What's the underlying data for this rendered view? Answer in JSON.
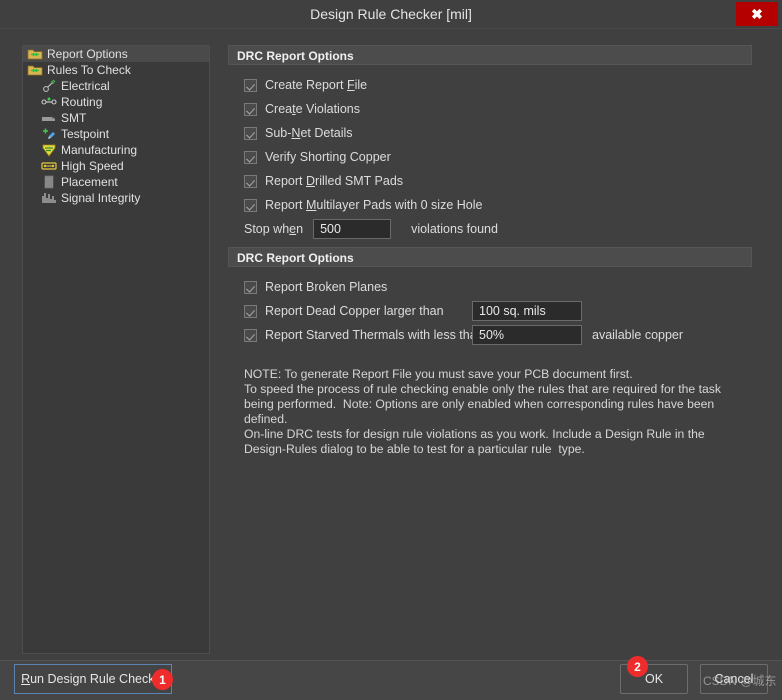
{
  "window": {
    "title": "Design Rule Checker [mil]",
    "close_label": "✖"
  },
  "sidebar": {
    "items": [
      {
        "label": "Report Options",
        "icon": "folder-arrows-icon",
        "level": 0,
        "selected": true
      },
      {
        "label": "Rules To Check",
        "icon": "folder-arrows-icon",
        "level": 0,
        "selected": false
      },
      {
        "label": "Electrical",
        "icon": "electrical-icon",
        "level": 1,
        "selected": false
      },
      {
        "label": "Routing",
        "icon": "routing-icon",
        "level": 1,
        "selected": false
      },
      {
        "label": "SMT",
        "icon": "smt-icon",
        "level": 1,
        "selected": false
      },
      {
        "label": "Testpoint",
        "icon": "testpoint-icon",
        "level": 1,
        "selected": false
      },
      {
        "label": "Manufacturing",
        "icon": "manufacturing-icon",
        "level": 1,
        "selected": false
      },
      {
        "label": "High Speed",
        "icon": "high-speed-icon",
        "level": 1,
        "selected": false
      },
      {
        "label": "Placement",
        "icon": "placement-icon",
        "level": 1,
        "selected": false
      },
      {
        "label": "Signal Integrity",
        "icon": "signal-integrity-icon",
        "level": 1,
        "selected": false
      }
    ]
  },
  "groups": [
    {
      "title": "DRC Report Options",
      "options": [
        {
          "type": "checkbox",
          "label": "Create Report File",
          "accel": "F",
          "checked": true
        },
        {
          "type": "checkbox",
          "label": "Create Violations",
          "accel": "t",
          "checked": true
        },
        {
          "type": "checkbox",
          "label": "Sub-Net Details",
          "accel": "N",
          "checked": true
        },
        {
          "type": "checkbox",
          "label": "Verify Shorting Copper",
          "accel": "",
          "checked": true
        },
        {
          "type": "checkbox",
          "label": "Report Drilled SMT Pads",
          "accel": "D",
          "checked": true
        },
        {
          "type": "checkbox",
          "label": "Report Multilayer Pads with 0 size Hole",
          "accel": "M",
          "checked": true
        },
        {
          "type": "field",
          "label": "Stop when",
          "accel": "e",
          "value": "500",
          "trailing": "violations found"
        }
      ]
    },
    {
      "title": "DRC Report Options",
      "options": [
        {
          "type": "checkbox",
          "label": "Report Broken Planes",
          "accel": "",
          "checked": true
        },
        {
          "type": "checkbox-field",
          "label": "Report Dead Copper larger than",
          "accel": "",
          "checked": true,
          "value": "100 sq. mils",
          "trailing": ""
        },
        {
          "type": "checkbox-field",
          "label": "Report Starved Thermals with less than",
          "accel": "",
          "checked": true,
          "value": "50%",
          "trailing": "available copper"
        }
      ]
    }
  ],
  "note": {
    "line1": "NOTE: To generate Report File you must save your PCB document first.",
    "line2": "To speed the process of rule checking enable only the rules that are required for the task",
    "line3": "being performed.  Note: Options are only enabled when corresponding rules have been",
    "line4": "defined.",
    "line5": "On-line DRC tests for design rule violations as you work. Include a Design Rule in the",
    "line6": "Design-Rules dialog to be able to test for a particular rule  type."
  },
  "footer": {
    "run_label": "Run Design Rule Check...",
    "run_accel": "R",
    "ok_label": "OK",
    "cancel_label": "Cancel",
    "badge_1": "1",
    "badge_2": "2"
  },
  "watermark": {
    "text": "CSDN @城东"
  },
  "colors": {
    "window_bg": "#404040",
    "panel_bg": "#3a3a3a",
    "header_bg": "#4c4c4c",
    "input_bg": "#2b2b2b",
    "close_red": "#b50000",
    "badge_red": "#ee2c2c",
    "focus_blue": "#5b84b1"
  }
}
